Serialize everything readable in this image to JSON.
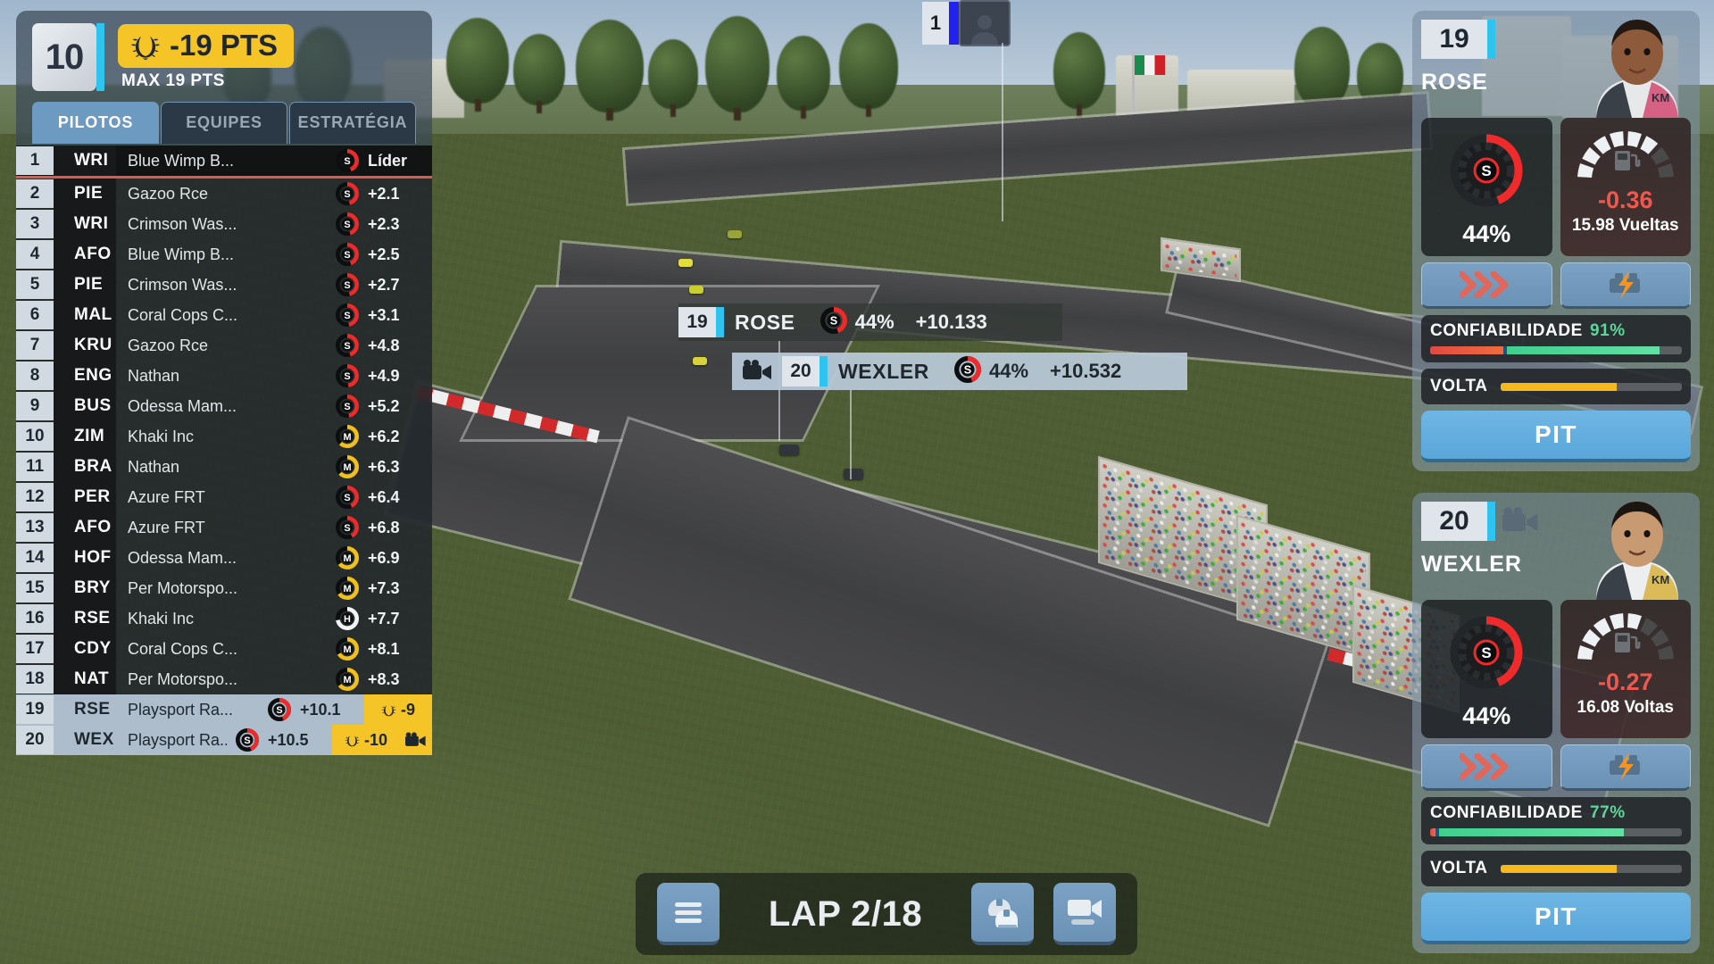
{
  "header": {
    "position": "10",
    "points_delta": "-19 PTS",
    "max_points": "MAX 19 PTS",
    "accent_cyan": "#2ec4ef",
    "points_yellow": "#f5c427"
  },
  "tabs": [
    {
      "label": "PILOTOS",
      "active": true
    },
    {
      "label": "EQUIPES",
      "active": false
    },
    {
      "label": "ESTRATÉGIA",
      "active": false
    }
  ],
  "standings": {
    "columns": [
      "pos",
      "driver",
      "team",
      "tyre",
      "gap",
      "points"
    ],
    "rows": [
      {
        "pos": "1",
        "driver": "WRI",
        "team": "Blue Wimp B...",
        "tyre": "S",
        "tyre_pct": 44,
        "gap": "Líder",
        "color": "#2233dd",
        "style": "leader"
      },
      {
        "pos": "2",
        "driver": "PIE",
        "team": "Gazoo Rce",
        "tyre": "S",
        "tyre_pct": 46,
        "gap": "+2.1",
        "color": "#f28ab4",
        "style": "dark"
      },
      {
        "pos": "3",
        "driver": "WRI",
        "team": "Crimson Was...",
        "tyre": "S",
        "tyre_pct": 45,
        "gap": "+2.3",
        "color": "#dd1122",
        "style": "dark"
      },
      {
        "pos": "4",
        "driver": "AFO",
        "team": "Blue Wimp B...",
        "tyre": "S",
        "tyre_pct": 44,
        "gap": "+2.5",
        "color": "#2233dd",
        "style": "dark"
      },
      {
        "pos": "5",
        "driver": "PIE",
        "team": "Crimson Was...",
        "tyre": "S",
        "tyre_pct": 46,
        "gap": "+2.7",
        "color": "#dd1122",
        "style": "dark"
      },
      {
        "pos": "6",
        "driver": "MAL",
        "team": "Coral Cops C...",
        "tyre": "S",
        "tyre_pct": 47,
        "gap": "+3.1",
        "color": "#f07a20",
        "style": "dark"
      },
      {
        "pos": "7",
        "driver": "KRU",
        "team": "Gazoo Rce",
        "tyre": "S",
        "tyre_pct": 45,
        "gap": "+4.8",
        "color": "#f28ab4",
        "style": "dark"
      },
      {
        "pos": "8",
        "driver": "ENG",
        "team": "Nathan",
        "tyre": "S",
        "tyre_pct": 48,
        "gap": "+4.9",
        "color": "#2f7df0",
        "style": "dark"
      },
      {
        "pos": "9",
        "driver": "BUS",
        "team": "Odessa Mam...",
        "tyre": "S",
        "tyre_pct": 47,
        "gap": "+5.2",
        "color": "#18c09a",
        "style": "dark"
      },
      {
        "pos": "10",
        "driver": "ZIM",
        "team": "Khaki Inc",
        "tyre": "M",
        "tyre_pct": 62,
        "gap": "+6.2",
        "color": "#f2e832",
        "style": "dark"
      },
      {
        "pos": "11",
        "driver": "BRA",
        "team": "Nathan",
        "tyre": "M",
        "tyre_pct": 63,
        "gap": "+6.3",
        "color": "#2f7df0",
        "style": "dark"
      },
      {
        "pos": "12",
        "driver": "PER",
        "team": "Azure FRT",
        "tyre": "S",
        "tyre_pct": 43,
        "gap": "+6.4",
        "color": "#e3c488",
        "style": "dark"
      },
      {
        "pos": "13",
        "driver": "AFO",
        "team": "Azure FRT",
        "tyre": "S",
        "tyre_pct": 42,
        "gap": "+6.8",
        "color": "#e3c488",
        "style": "dark"
      },
      {
        "pos": "14",
        "driver": "HOF",
        "team": "Odessa Mam...",
        "tyre": "M",
        "tyre_pct": 64,
        "gap": "+6.9",
        "color": "#18c09a",
        "style": "dark"
      },
      {
        "pos": "15",
        "driver": "BRY",
        "team": "Per Motorspo...",
        "tyre": "M",
        "tyre_pct": 65,
        "gap": "+7.3",
        "color": "#ffffff",
        "style": "dark"
      },
      {
        "pos": "16",
        "driver": "RSE",
        "team": "Khaki Inc",
        "tyre": "H",
        "tyre_pct": 72,
        "gap": "+7.7",
        "color": "#f2e832",
        "style": "dark"
      },
      {
        "pos": "17",
        "driver": "CDY",
        "team": "Coral Cops C...",
        "tyre": "M",
        "tyre_pct": 66,
        "gap": "+8.1",
        "color": "#f07a20",
        "style": "dark"
      },
      {
        "pos": "18",
        "driver": "NAT",
        "team": "Per Motorspo...",
        "tyre": "M",
        "tyre_pct": 64,
        "gap": "+8.3",
        "color": "#ffffff",
        "style": "dark"
      },
      {
        "pos": "19",
        "driver": "RSE",
        "team": "Playsport Ra...",
        "tyre": "S",
        "tyre_pct": 44,
        "gap": "+10.1",
        "color": "#2ec4ef",
        "style": "me",
        "points": "-9"
      },
      {
        "pos": "20",
        "driver": "WEX",
        "team": "Playsport Ra...",
        "tyre": "S",
        "tyre_pct": 44,
        "gap": "+10.5",
        "color": "#2ec4ef",
        "style": "me",
        "points": "-10",
        "camera": true
      }
    ]
  },
  "track_labels": {
    "leader": {
      "pos": "1",
      "color": "#2222ee"
    },
    "rose": {
      "pos": "19",
      "name": "ROSE",
      "tyre": "S",
      "tyre_pct": 44,
      "pct": "44%",
      "gap": "+10.133"
    },
    "wexler": {
      "pos": "20",
      "name": "WEXLER",
      "tyre": "S",
      "tyre_pct": 44,
      "pct": "44%",
      "gap": "+10.532",
      "camera": true
    }
  },
  "driver_cards": [
    {
      "number": "19",
      "name": "ROSE",
      "camera": false,
      "tyre_letter": "S",
      "tyre_pct_label": "44%",
      "tyre_pct": 44,
      "fuel_delta": "-0.36",
      "fuel_laps": "15.98 Vueltas",
      "fuel_segments_lit": 6,
      "fuel_segments_total": 8,
      "reliability_label": "CONFIABILIDADE",
      "reliability_value": "91%",
      "reliability_pct": 91,
      "reliability_damage_pct": 29,
      "lap_label": "VOLTA",
      "lap_pct": 64,
      "pit_label": "PIT",
      "push_icon": "triple-chevron-icon",
      "engine_icon": "engine-boost-icon"
    },
    {
      "number": "20",
      "name": "WEXLER",
      "camera": true,
      "tyre_letter": "S",
      "tyre_pct_label": "44%",
      "tyre_pct": 44,
      "fuel_delta": "-0.27",
      "fuel_laps": "16.08 Voltas",
      "fuel_segments_lit": 5,
      "fuel_segments_total": 8,
      "reliability_label": "CONFIABILIDADE",
      "reliability_value": "77%",
      "reliability_pct": 77,
      "reliability_damage_pct": 2,
      "lap_label": "VOLTA",
      "lap_pct": 64,
      "pit_label": "PIT",
      "push_icon": "triple-chevron-icon",
      "engine_icon": "engine-boost-icon"
    }
  ],
  "bottom_bar": {
    "lap_text": "LAP 2/18",
    "menu_icon": "hamburger-menu-icon",
    "helmet_icon": "helmets-icon",
    "camera_icon": "camera-icon"
  }
}
